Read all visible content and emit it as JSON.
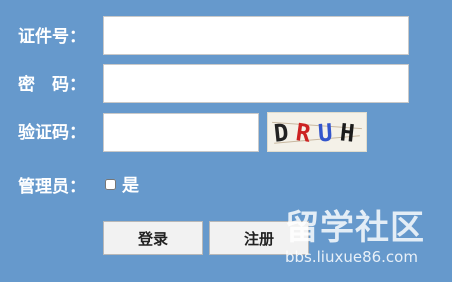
{
  "form": {
    "id_number_label": "证件号：",
    "password_label": "密　码：",
    "captcha_label": "验证码：",
    "admin_label": "管理员：",
    "admin_option_label": "是",
    "id_number_value": "",
    "password_value": "",
    "captcha_value": ""
  },
  "captcha_image": {
    "chars": [
      "D",
      "R",
      "U",
      "H"
    ],
    "colors": [
      "#222222",
      "#cc2222",
      "#3355cc",
      "#1a1a1a"
    ]
  },
  "buttons": {
    "login_label": "登录",
    "register_label": "注册"
  },
  "watermark": {
    "title": "留学社区",
    "url": "bbs.liuxue86.com"
  }
}
